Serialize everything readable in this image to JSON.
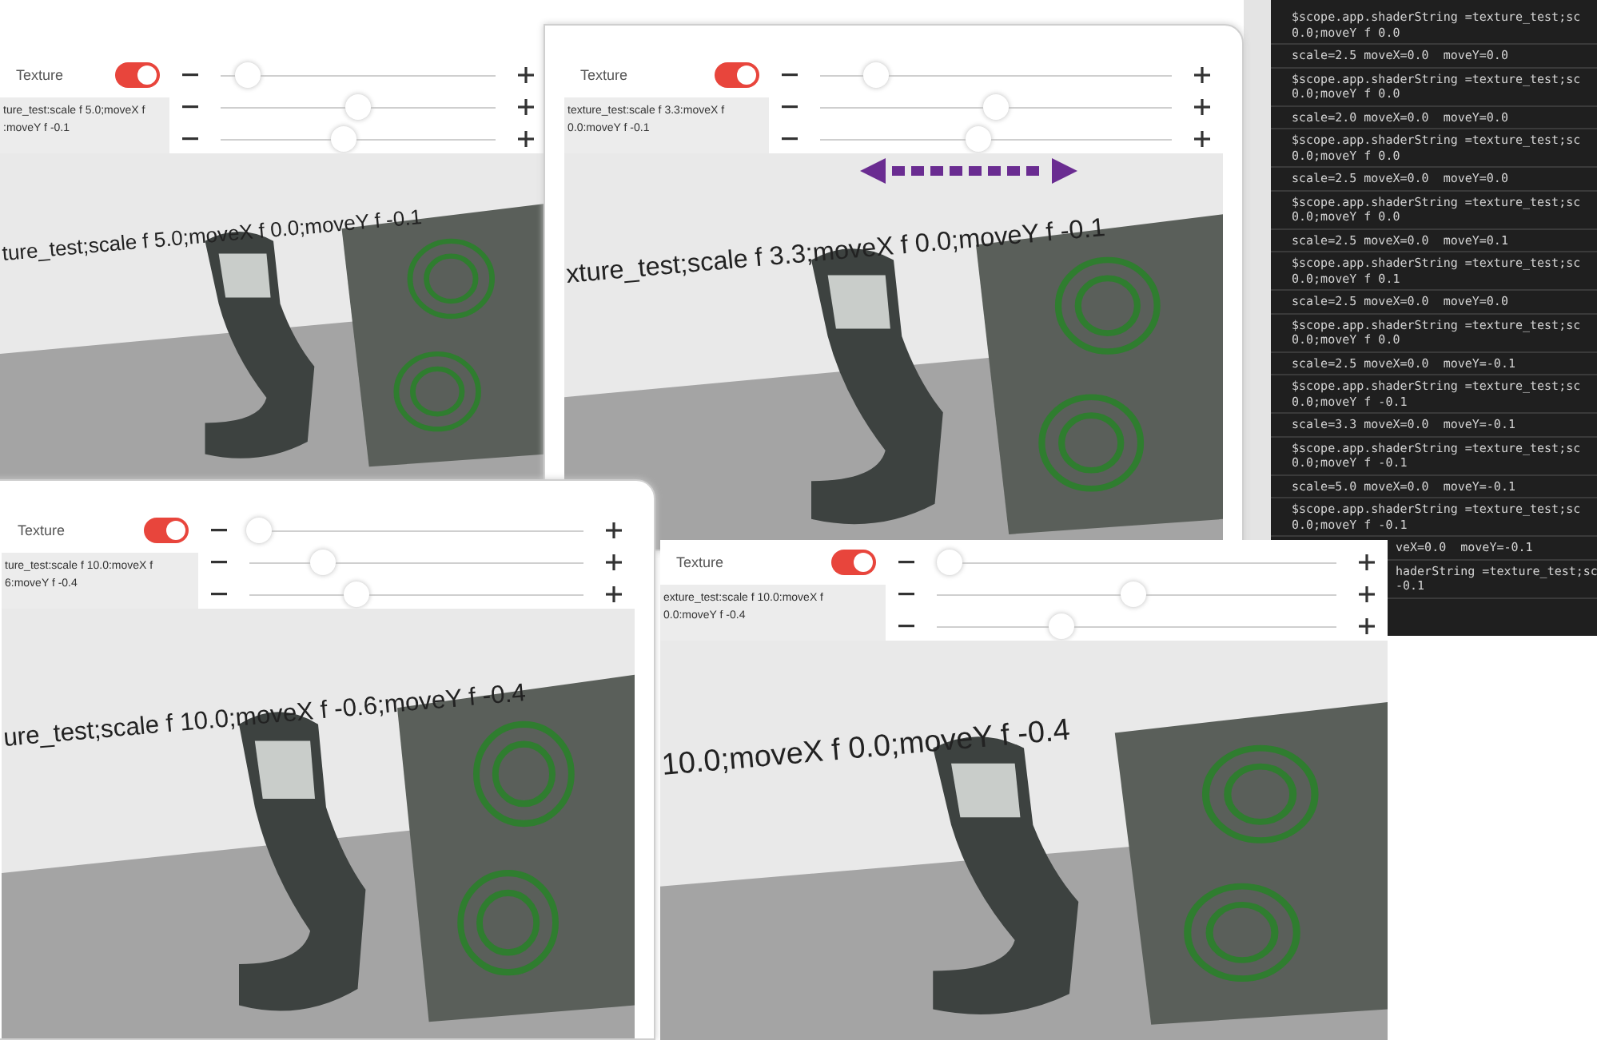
{
  "windows": [
    {
      "label": "Texture",
      "toggle_on": true,
      "caption_lines": [
        "ture_test:scale f 5.0;moveX f",
        ":moveY f -0.1"
      ],
      "sliders": [
        {
          "level": 0.1
        },
        {
          "level": 0.5
        },
        {
          "level": 0.45
        }
      ],
      "overlay_text": "ture_test;scale f 5.0;moveX f 0.0;moveY f -0.1",
      "arrow_annotation": false
    },
    {
      "label": "Texture",
      "toggle_on": true,
      "caption_lines": [
        "texture_test:scale f 3.3:moveX f",
        "0.0:moveY f -0.1"
      ],
      "sliders": [
        {
          "level": 0.16
        },
        {
          "level": 0.5
        },
        {
          "level": 0.45
        }
      ],
      "overlay_text": "xture_test;scale f 3.3;moveX f 0.0;moveY f -0.1",
      "arrow_annotation": true
    },
    {
      "label": "Texture",
      "toggle_on": true,
      "caption_lines": [
        "ture_test:scale f 10.0:moveX f",
        "6:moveY f -0.4"
      ],
      "sliders": [
        {
          "level": 0.03
        },
        {
          "level": 0.22
        },
        {
          "level": 0.32
        }
      ],
      "overlay_text": "ure_test;scale f 10.0;moveX f -0.6;moveY f -0.4",
      "arrow_annotation": false
    },
    {
      "label": "Texture",
      "toggle_on": true,
      "caption_lines": [
        "exture_test:scale f 10.0:moveX f",
        "0.0:moveY f -0.4"
      ],
      "sliders": [
        {
          "level": 0.03
        },
        {
          "level": 0.49
        },
        {
          "level": 0.31
        }
      ],
      "overlay_text": "10.0;moveX f 0.0;moveY f -0.4",
      "arrow_annotation": false
    }
  ],
  "console": {
    "entries": [
      {
        "kind": "full",
        "lines": [
          "$scope.app.shaderString =texture_test;sc",
          "0.0;moveY f 0.0"
        ]
      },
      {
        "kind": "full",
        "lines": [
          "scale=2.5 moveX=0.0  moveY=0.0"
        ]
      },
      {
        "kind": "full",
        "lines": [
          "$scope.app.shaderString =texture_test;sc",
          "0.0;moveY f 0.0"
        ]
      },
      {
        "kind": "full",
        "lines": [
          "scale=2.0 moveX=0.0  moveY=0.0"
        ]
      },
      {
        "kind": "full",
        "lines": [
          "$scope.app.shaderString =texture_test;sc",
          "0.0;moveY f 0.0"
        ]
      },
      {
        "kind": "full",
        "lines": [
          "scale=2.5 moveX=0.0  moveY=0.0"
        ]
      },
      {
        "kind": "full",
        "lines": [
          "$scope.app.shaderString =texture_test;sc",
          "0.0;moveY f 0.0"
        ]
      },
      {
        "kind": "full",
        "lines": [
          "scale=2.5 moveX=0.0  moveY=0.1"
        ]
      },
      {
        "kind": "full",
        "lines": [
          "$scope.app.shaderString =texture_test;sc",
          "0.0;moveY f 0.1"
        ]
      },
      {
        "kind": "full",
        "lines": [
          "scale=2.5 moveX=0.0  moveY=0.0"
        ]
      },
      {
        "kind": "full",
        "lines": [
          "$scope.app.shaderString =texture_test;sc",
          "0.0;moveY f 0.0"
        ]
      },
      {
        "kind": "full",
        "lines": [
          "scale=2.5 moveX=0.0  moveY=-0.1"
        ]
      },
      {
        "kind": "full",
        "lines": [
          "$scope.app.shaderString =texture_test;sc",
          "0.0;moveY f -0.1"
        ]
      },
      {
        "kind": "full",
        "lines": [
          "scale=3.3 moveX=0.0  moveY=-0.1"
        ]
      },
      {
        "kind": "full",
        "lines": [
          "$scope.app.shaderString =texture_test;sc",
          "0.0;moveY f -0.1"
        ]
      },
      {
        "kind": "full",
        "lines": [
          "scale=5.0 moveX=0.0  moveY=-0.1"
        ]
      },
      {
        "kind": "full",
        "lines": [
          "$scope.app.shaderString =texture_test;sc",
          "0.0;moveY f -0.1"
        ]
      },
      {
        "kind": "clipped",
        "lines": [
          "veX=0.0  moveY=-0.1"
        ]
      },
      {
        "kind": "clipped",
        "lines": [
          "haderString =texture_test;sc",
          "-0.1"
        ]
      }
    ]
  }
}
